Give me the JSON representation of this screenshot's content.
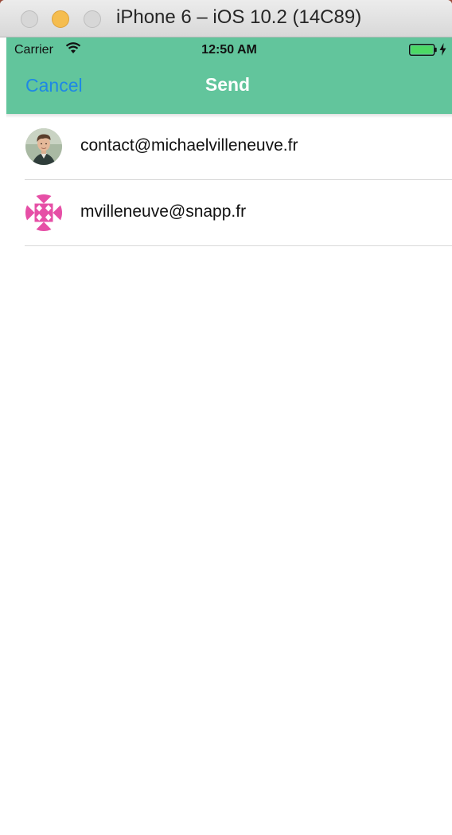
{
  "window": {
    "title": "iPhone 6 – iOS 10.2 (14C89)"
  },
  "status_bar": {
    "carrier": "Carrier",
    "time": "12:50 AM",
    "icons": [
      "wifi-icon",
      "battery-icon",
      "charging-bolt-icon"
    ]
  },
  "navbar": {
    "cancel_label": "Cancel",
    "title": "Send",
    "background_color": "#62c59c",
    "cancel_color": "#1e88e5"
  },
  "contacts": [
    {
      "email": "contact@michaelvilleneuve.fr",
      "avatar": "photo-avatar"
    },
    {
      "email": "mvilleneuve@snapp.fr",
      "avatar": "identicon-avatar"
    }
  ]
}
